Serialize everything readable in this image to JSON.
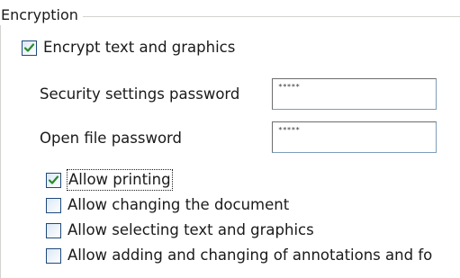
{
  "group": {
    "title": "Encryption"
  },
  "encrypt": {
    "label": "Encrypt text and graphics",
    "checked": true
  },
  "fields": {
    "security_password_label": "Security settings password",
    "security_password_value": "*****",
    "open_password_label": "Open file password",
    "open_password_value": "*****"
  },
  "permissions": [
    {
      "label": "Allow printing",
      "checked": true
    },
    {
      "label": "Allow changing the document",
      "checked": false
    },
    {
      "label": "Allow selecting text and graphics",
      "checked": false
    },
    {
      "label": "Allow adding and changing of annotations and fo",
      "checked": false
    }
  ],
  "colors": {
    "check_mark": "#2a8a2a",
    "checkbox_border": "#1f4a7a",
    "group_line": "#d3d3cf"
  }
}
